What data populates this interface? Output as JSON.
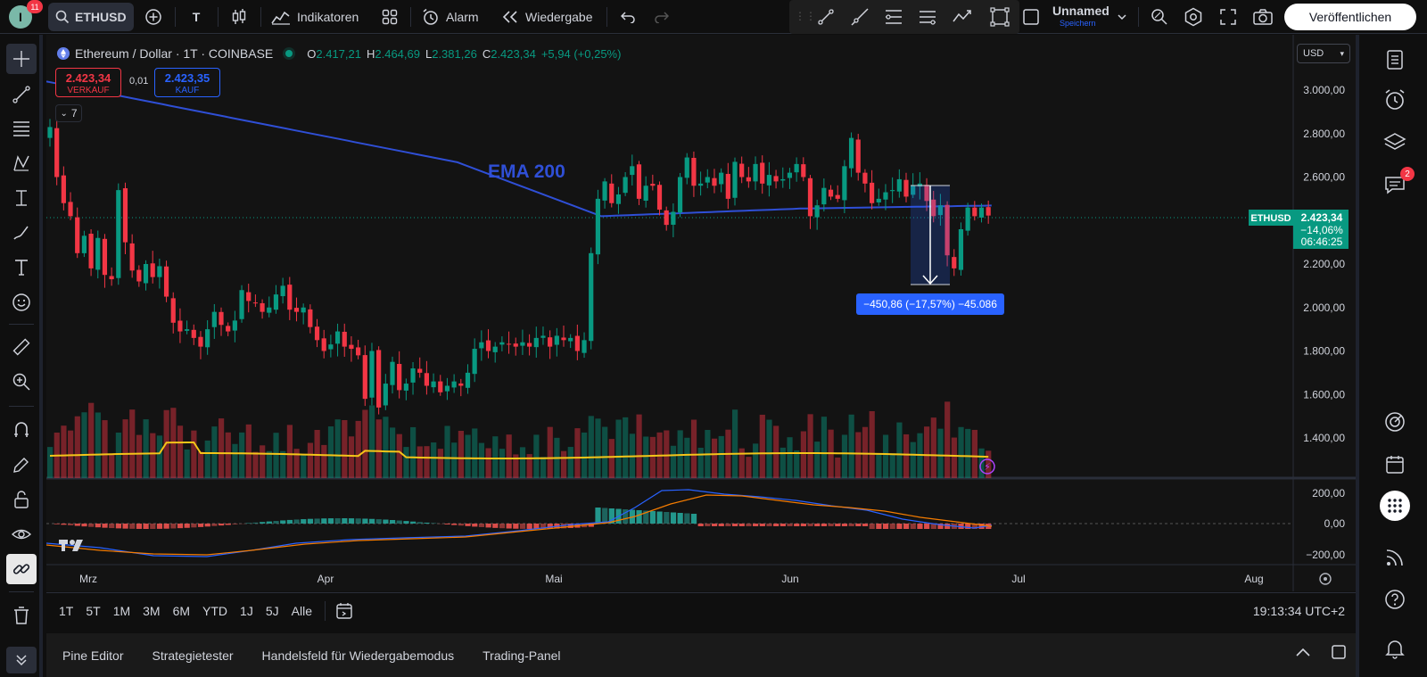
{
  "topbar": {
    "avatar_letter": "I",
    "notif_count": "11",
    "symbol": "ETHUSD",
    "interval": "T",
    "indicators_label": "Indikatoren",
    "alarm_label": "Alarm",
    "replay_label": "Wiedergabe",
    "layout_name": "Unnamed",
    "layout_sub": "Speichern",
    "publish_label": "Veröffentlichen"
  },
  "legend": {
    "title": "Ethereum / Dollar · 1T · COINBASE",
    "o_label": "O",
    "o_value": "2.417,21",
    "h_label": "H",
    "h_value": "2.464,69",
    "l_label": "L",
    "l_value": "2.381,26",
    "c_label": "C",
    "c_value": "2.423,34",
    "change": "+5,94 (+0,25%)",
    "sell_price": "2.423,34",
    "sell_label": "VERKAUF",
    "spread": "0,01",
    "buy_price": "2.423,35",
    "buy_label": "KAUF",
    "collapse_count": "7",
    "currency": "USD"
  },
  "chart_data": {
    "type": "candlestick",
    "symbol": "ETHUSD",
    "annotation": "EMA 200",
    "measure_label": "−450,86 (−17,57%) −45.086",
    "price_axis": [
      "3.000,00",
      "2.800,00",
      "2.600,00",
      "2.400,00",
      "2.200,00",
      "2.000,00",
      "1.800,00",
      "1.600,00",
      "1.400,00"
    ],
    "ylim": [
      1250,
      3100
    ],
    "time_axis": [
      "Mrz",
      "Apr",
      "Mai",
      "Jun",
      "Jul",
      "Aug"
    ],
    "last_label": "ETHUSD",
    "last_price": "2.423,34",
    "last_change": "−14,06%",
    "countdown": "06:46:25",
    "macd_axis": [
      "200,00",
      "0,00",
      "−200,00"
    ],
    "closes": [
      2830,
      2600,
      2480,
      2420,
      2250,
      2330,
      2180,
      2320,
      2150,
      2130,
      2540,
      2300,
      2170,
      2120,
      2200,
      2140,
      2190,
      2050,
      1930,
      1890,
      1900,
      1860,
      1820,
      1900,
      1980,
      1920,
      1890,
      1940,
      2080,
      2030,
      2020,
      1980,
      2000,
      2060,
      2100,
      1990,
      1980,
      2000,
      1910,
      1850,
      1800,
      1830,
      1890,
      1820,
      1810,
      1780,
      1580,
      1800,
      1540,
      1650,
      1750,
      1620,
      1650,
      1720,
      1700,
      1640,
      1660,
      1610,
      1640,
      1660,
      1640,
      1700,
      1810,
      1840,
      1800,
      1820,
      1840,
      1830,
      1820,
      1840,
      1820,
      1860,
      1870,
      1820,
      1870,
      1850,
      1860,
      1800,
      1850,
      2250,
      2500,
      2580,
      2480,
      2520,
      2600,
      2650,
      2500,
      2560,
      2560,
      2450,
      2380,
      2440,
      2600,
      2690,
      2560,
      2570,
      2600,
      2560,
      2620,
      2500,
      2670,
      2600,
      2580,
      2660,
      2570,
      2610,
      2580,
      2590,
      2620,
      2660,
      2600,
      2420,
      2470,
      2550,
      2510,
      2500,
      2650,
      2780,
      2620,
      2570,
      2480,
      2500,
      2530,
      2540,
      2590,
      2510,
      2560,
      2570,
      2490,
      2420,
      2470,
      2240,
      2180,
      2360,
      2460,
      2420,
      2460,
      2423
    ],
    "volume_ma": "yellow line",
    "oscillator": "MACD"
  },
  "timeframes": [
    "1T",
    "5T",
    "1M",
    "3M",
    "6M",
    "YTD",
    "1J",
    "5J",
    "Alle"
  ],
  "clock": "19:13:34 UTC+2",
  "bottom_tabs": [
    "Pine Editor",
    "Strategietester",
    "Handelsfeld für Wiedergabemodus",
    "Trading-Panel"
  ],
  "right_notif": "2",
  "colors": {
    "up": "#089981",
    "down": "#f23645",
    "ema": "#2f4fd6",
    "accent": "#2962ff",
    "vol_ma": "#f5c518"
  }
}
